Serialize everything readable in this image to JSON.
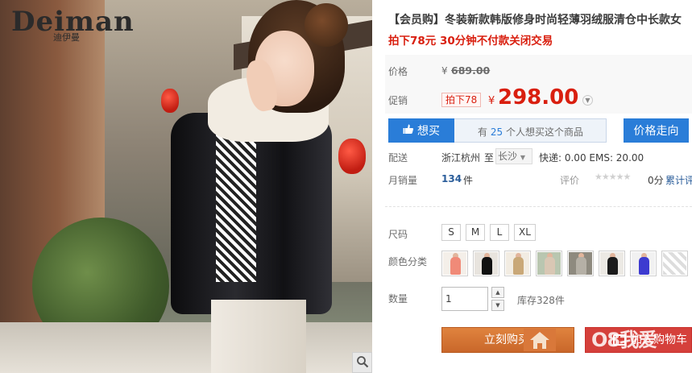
{
  "brand": {
    "name": "Deiman",
    "name_cn": "迪伊曼"
  },
  "product": {
    "title": "【会员购】冬装新款韩版修身时尚轻薄羽绒服清仓中长款女",
    "subtitle": "拍下78元 30分钟不付款关闭交易"
  },
  "price": {
    "label": "价格",
    "currency": "¥",
    "original": "689.00",
    "promo_label": "促销",
    "promo_tag": "拍下78",
    "current": "298.00"
  },
  "want": {
    "button": "想买",
    "prefix": "有",
    "count": "25",
    "suffix": "个人想买这个商品"
  },
  "price_trend": "价格走向",
  "shipping": {
    "label": "配送",
    "from": "浙江杭州",
    "to_word": "至",
    "destination": "长沙",
    "fee": "快递: 0.00 EMS: 20.00"
  },
  "sales": {
    "label": "月销量",
    "count": "134",
    "unit": "件",
    "rating_label": "评价",
    "stars": "★★★★★",
    "score": "0分",
    "reviews": "累计评"
  },
  "options": {
    "size_label": "尺码",
    "sizes": [
      "S",
      "M",
      "L",
      "XL"
    ],
    "color_label": "颜色分类",
    "swatches": [
      {
        "color": "#f08a78",
        "bg": "#f4efe9"
      },
      {
        "color": "#111111",
        "bg": "#e8e4de"
      },
      {
        "color": "#c9a878",
        "bg": "#f2ece2"
      },
      {
        "color": "#d9c7b4",
        "bg": "#b9c6b0"
      },
      {
        "color": "#b5b0a6",
        "bg": "#8e8a7f"
      },
      {
        "color": "#1b1b1b",
        "bg": "#ece9e4"
      },
      {
        "color": "#3d3bd0",
        "bg": "#f1f1f1"
      },
      {
        "color": "#c9c9c9",
        "bg": "#ffffff"
      }
    ]
  },
  "quantity": {
    "label": "数量",
    "value": "1",
    "stock": "库存328件"
  },
  "actions": {
    "buy": "立刻购买",
    "cart": "加入购物车",
    "watermark": "O8我爱"
  }
}
